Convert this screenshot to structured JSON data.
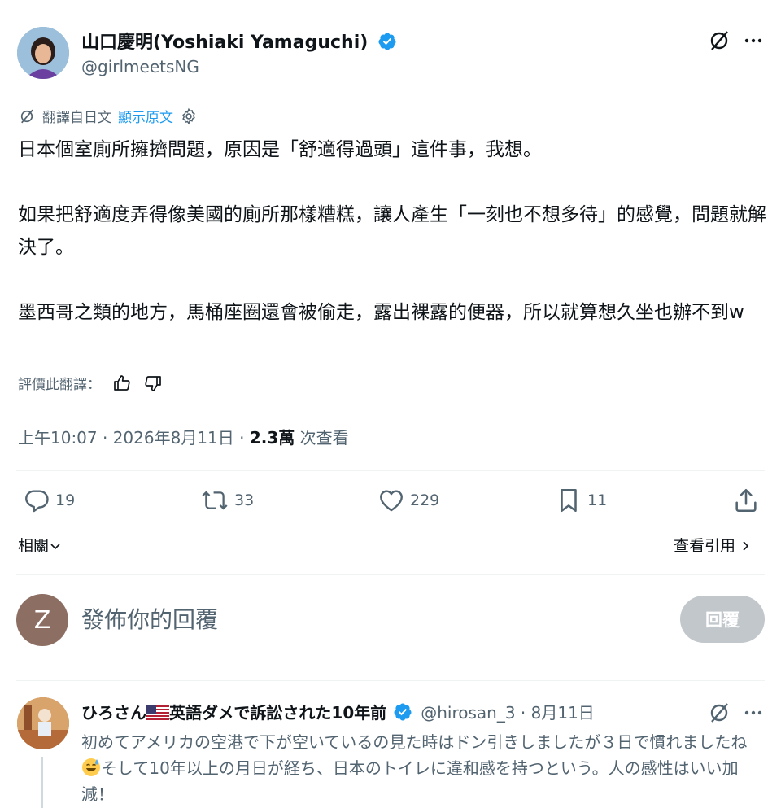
{
  "author": {
    "name": "山口慶明(Yoshiaki Yamaguchi)",
    "handle": "@girlmeetsNG"
  },
  "translation": {
    "label": "翻譯自日文",
    "show_original": "顯示原文"
  },
  "tweet": {
    "paragraphs": [
      "日本個室廁所擁擠問題，原因是「舒適得過頭」這件事，我想。",
      "",
      "如果把舒適度弄得像美國的廁所那樣糟糕，讓人產生「一刻也不想多待」的感覺，問題就解決了。",
      "",
      "墨西哥之類的地方，馬桶座圈還會被偷走，露出裸露的便器，所以就算想久坐也辦不到w"
    ]
  },
  "rate_translation": "評價此翻譯：",
  "meta": {
    "time": "上午10:07 · 2026年8月11日 · ",
    "views": "2.3萬",
    "views_label": " 次查看"
  },
  "actions": {
    "replies": "19",
    "retweets": "33",
    "likes": "229",
    "bookmarks": "11"
  },
  "related": "相關",
  "view_quotes": "查看引用",
  "composer": {
    "avatar_letter": "Z",
    "placeholder": "發佈你的回覆",
    "button": "回覆"
  },
  "reply": {
    "name_part1": "ひろさん",
    "name_part2": "英語ダメで訴訟された10年前",
    "handle_time": "@hirosan_3 · 8月11日",
    "text_part1": "初めてアメリカの空港で下が空いているの見た時はドン引きしましたが３日で慣れましたね",
    "text_part2": "そして10年以上の月日が経ち、日本のトイレに違和感を持つという。人の感性はいい加減！"
  },
  "colors": {
    "accent": "#1d9bf0",
    "secondary_text": "#536471",
    "primary_text": "#0f1419",
    "disabled_button": "#c2c7cb"
  }
}
